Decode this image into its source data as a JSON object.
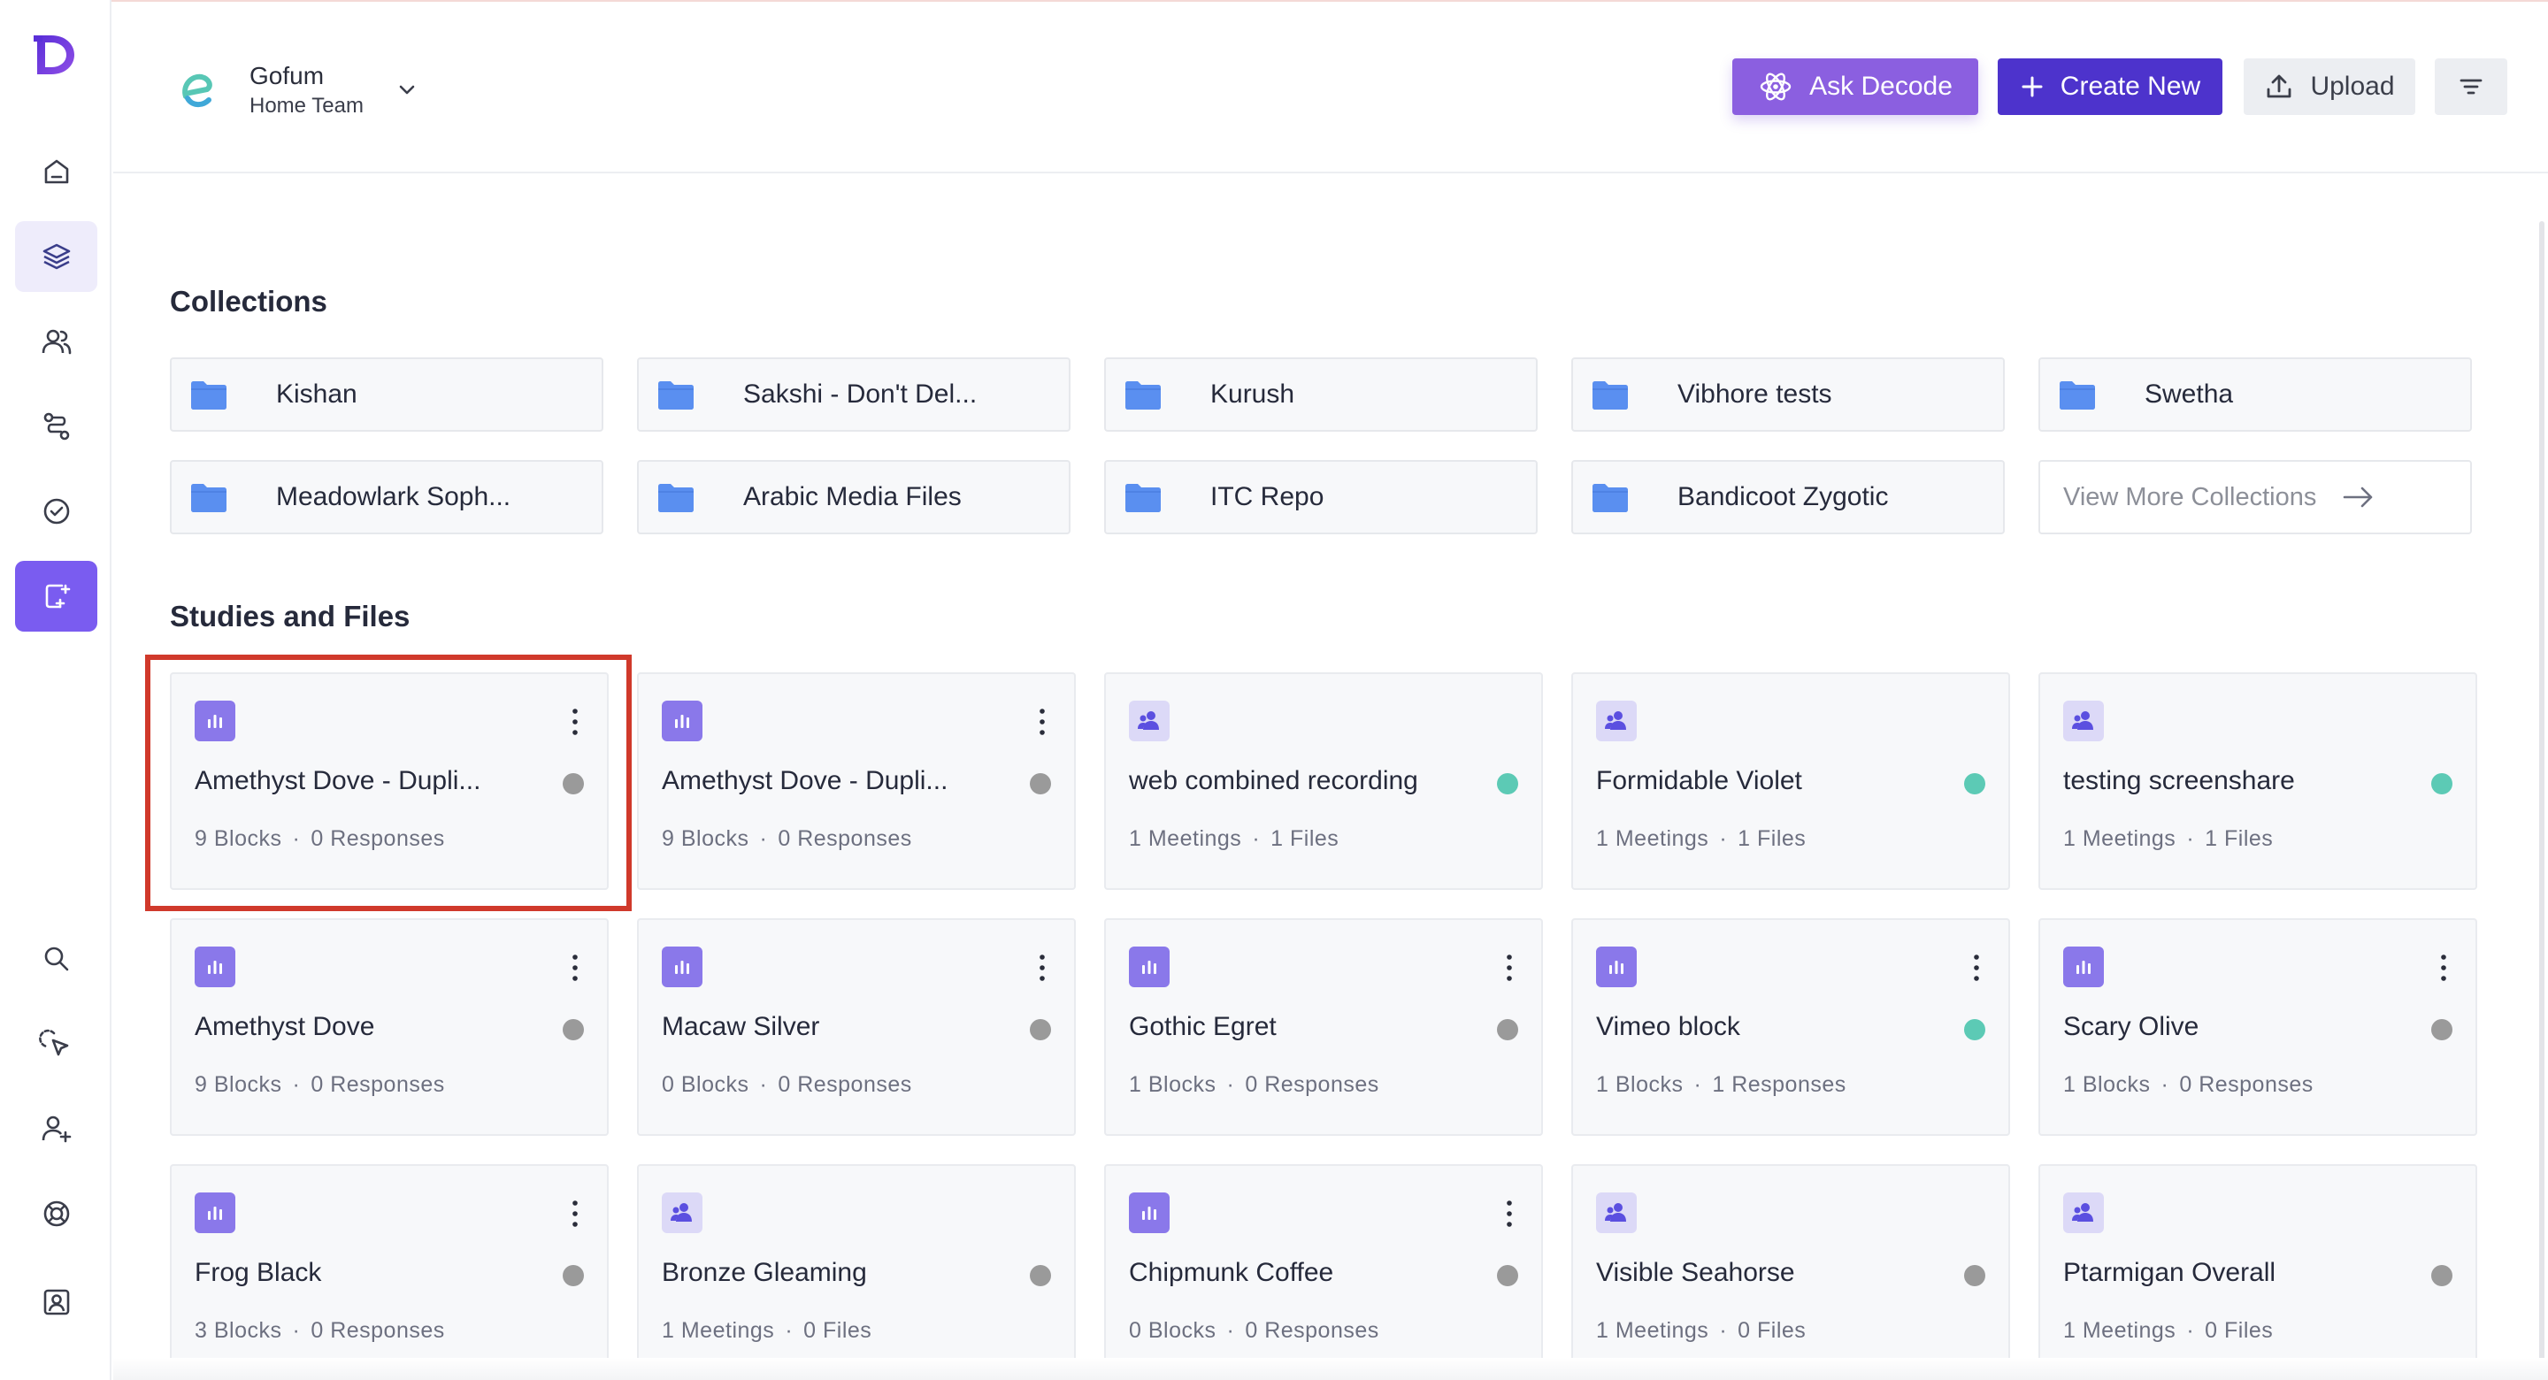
{
  "app": {
    "team_name": "Gofum",
    "team_sub": "Home Team"
  },
  "header": {
    "ask_label": "Ask Decode",
    "create_label": "Create New",
    "upload_label": "Upload"
  },
  "sidebar_icons": [
    "home-icon",
    "layers-icon",
    "users-icon",
    "route-icon",
    "check-badge-icon",
    "new-file-icon",
    "search-icon",
    "pointer-click-icon",
    "add-user-icon",
    "lifebuoy-icon",
    "profile-card-icon"
  ],
  "collections": {
    "title": "Collections",
    "items": [
      "Kishan",
      "Sakshi - Don't Del...",
      "Kurush",
      "Vibhore tests",
      "Swetha",
      "Meadowlark Soph...",
      "Arabic Media Files",
      "ITC Repo",
      "Bandicoot Zygotic"
    ],
    "view_more_label": "View More Collections"
  },
  "studies": {
    "title": "Studies and Files",
    "items": [
      {
        "type": "survey",
        "title": "Amethyst Dove - Dupli...",
        "status": "grey",
        "n1": "9",
        "l1": "Blocks",
        "n2": "0",
        "l2": "Responses"
      },
      {
        "type": "survey",
        "title": "Amethyst Dove - Dupli...",
        "status": "grey",
        "n1": "9",
        "l1": "Blocks",
        "n2": "0",
        "l2": "Responses"
      },
      {
        "type": "meeting",
        "title": "web combined recording",
        "status": "green",
        "n1": "1",
        "l1": "Meetings",
        "n2": "1",
        "l2": "Files"
      },
      {
        "type": "meeting",
        "title": "Formidable Violet",
        "status": "green",
        "n1": "1",
        "l1": "Meetings",
        "n2": "1",
        "l2": "Files"
      },
      {
        "type": "meeting",
        "title": "testing screenshare",
        "status": "green",
        "n1": "1",
        "l1": "Meetings",
        "n2": "1",
        "l2": "Files"
      },
      {
        "type": "survey",
        "title": "Amethyst Dove",
        "status": "grey",
        "n1": "9",
        "l1": "Blocks",
        "n2": "0",
        "l2": "Responses"
      },
      {
        "type": "survey",
        "title": "Macaw Silver",
        "status": "grey",
        "n1": "0",
        "l1": "Blocks",
        "n2": "0",
        "l2": "Responses"
      },
      {
        "type": "survey",
        "title": "Gothic Egret",
        "status": "grey",
        "n1": "1",
        "l1": "Blocks",
        "n2": "0",
        "l2": "Responses"
      },
      {
        "type": "survey",
        "title": "Vimeo block",
        "status": "green",
        "n1": "1",
        "l1": "Blocks",
        "n2": "1",
        "l2": "Responses"
      },
      {
        "type": "survey",
        "title": "Scary Olive",
        "status": "grey",
        "n1": "1",
        "l1": "Blocks",
        "n2": "0",
        "l2": "Responses"
      },
      {
        "type": "survey",
        "title": "Frog Black",
        "status": "grey",
        "n1": "3",
        "l1": "Blocks",
        "n2": "0",
        "l2": "Responses"
      },
      {
        "type": "meeting",
        "title": "Bronze Gleaming",
        "status": "grey",
        "n1": "1",
        "l1": "Meetings",
        "n2": "0",
        "l2": "Files"
      },
      {
        "type": "survey",
        "title": "Chipmunk Coffee",
        "status": "grey",
        "n1": "0",
        "l1": "Blocks",
        "n2": "0",
        "l2": "Responses"
      },
      {
        "type": "meeting",
        "title": "Visible Seahorse",
        "status": "grey",
        "n1": "1",
        "l1": "Meetings",
        "n2": "0",
        "l2": "Files"
      },
      {
        "type": "meeting",
        "title": "Ptarmigan Overall",
        "status": "grey",
        "n1": "1",
        "l1": "Meetings",
        "n2": "0",
        "l2": "Files"
      }
    ]
  },
  "colors": {
    "accent": "#4d33cc",
    "ask": "#8b5fe0",
    "status_green": "#5ccab5",
    "status_grey": "#9a9a9a",
    "highlight": "#d0392b"
  }
}
